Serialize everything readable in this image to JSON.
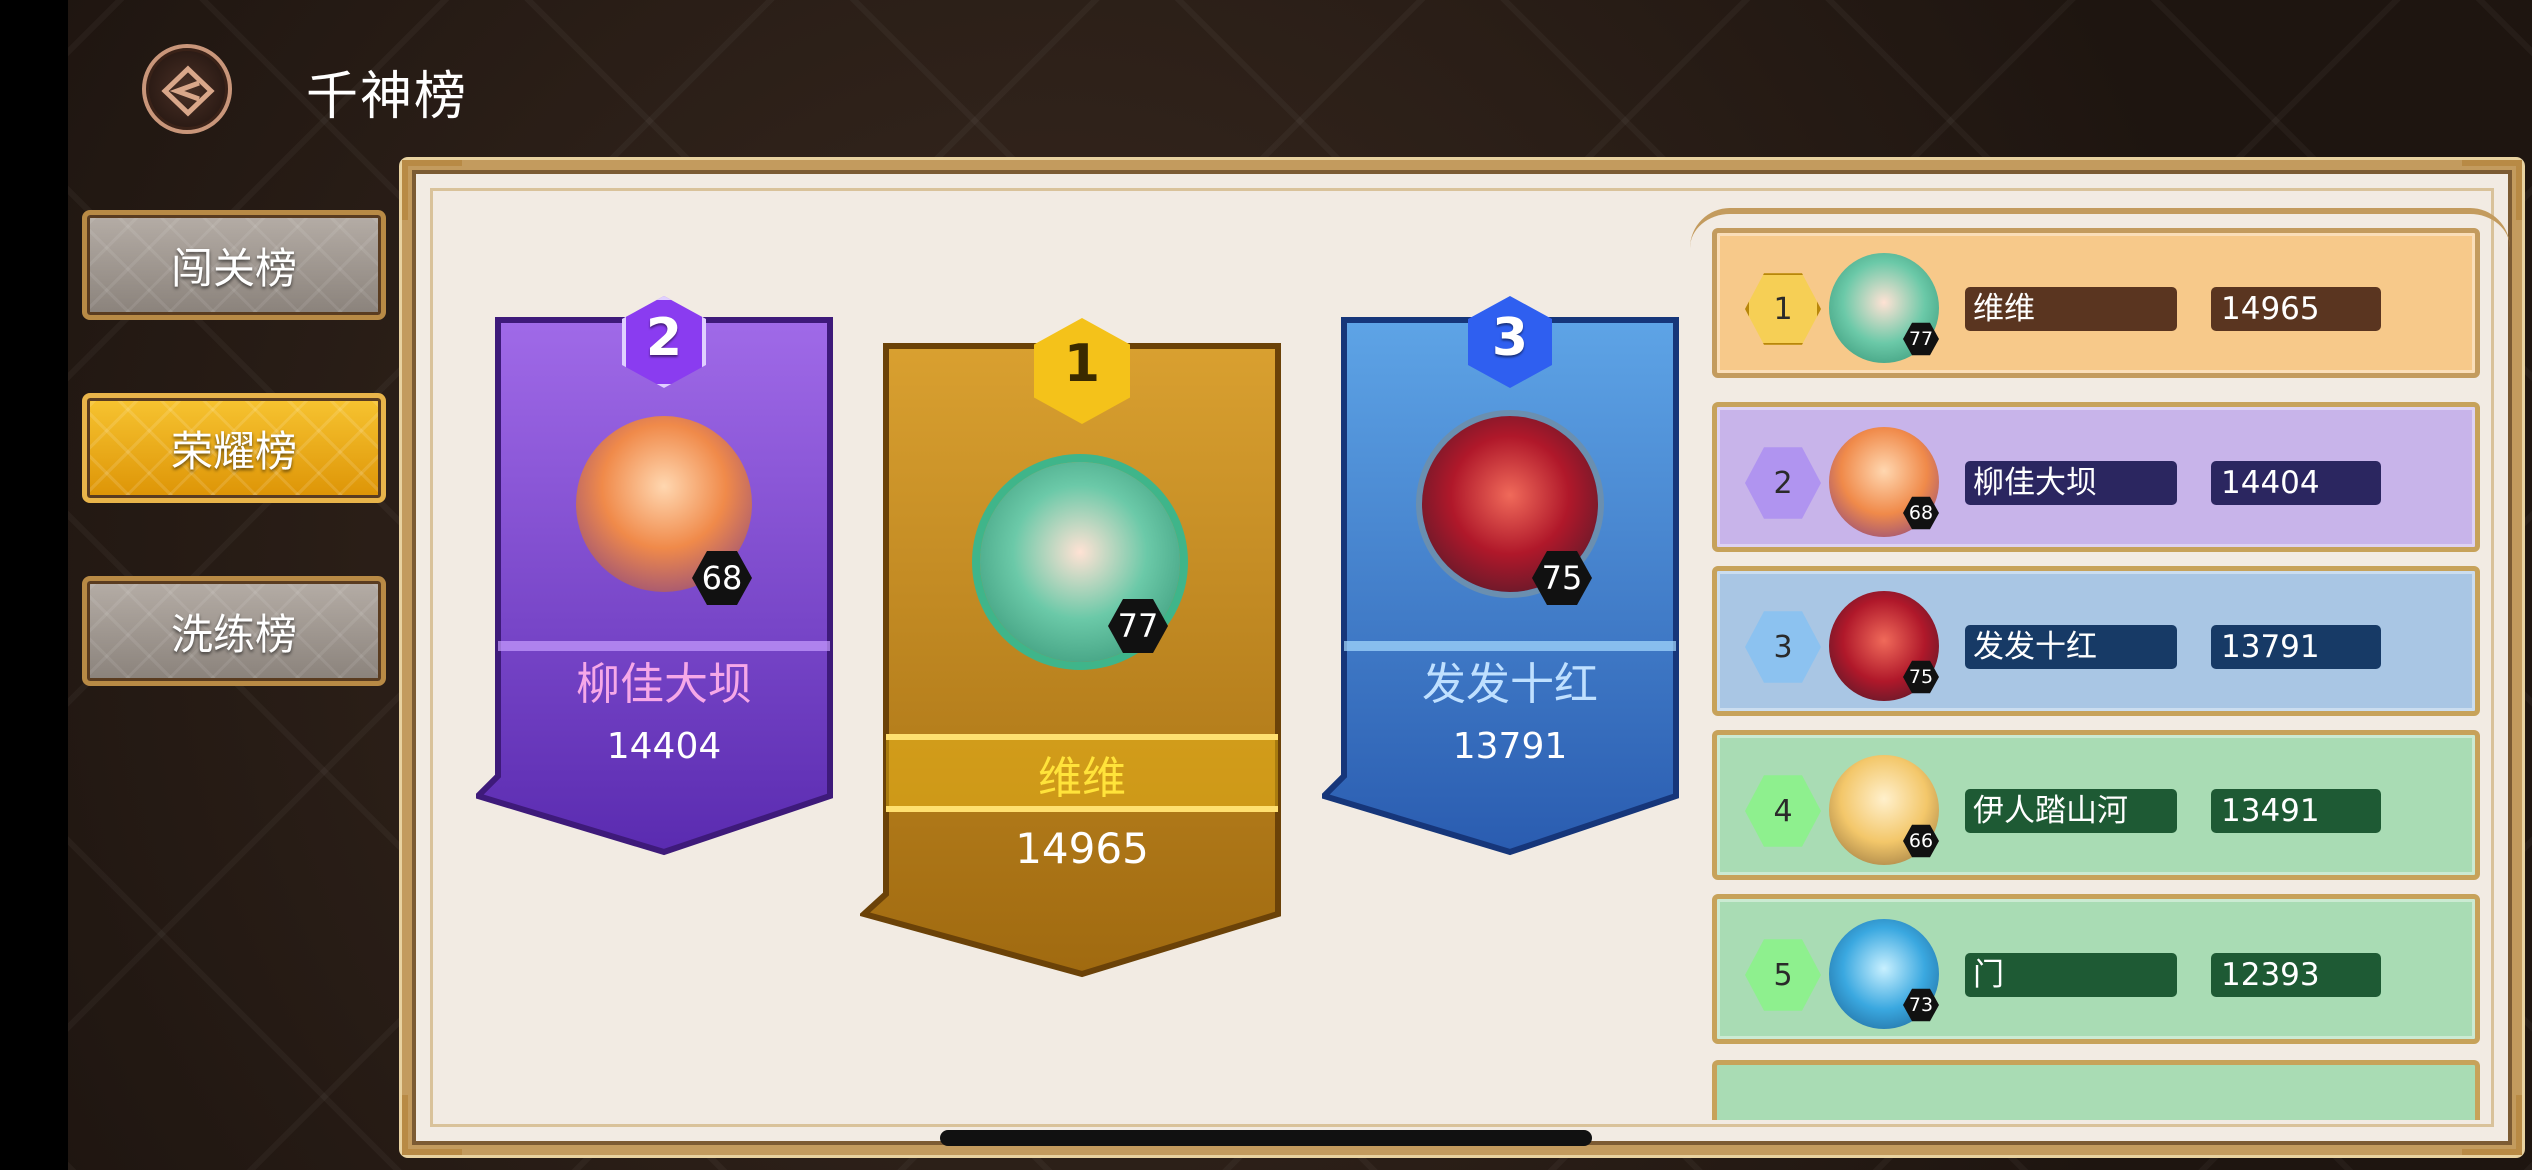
{
  "header": {
    "title": "千神榜",
    "back_icon": "back-arrow-icon"
  },
  "tabs": [
    {
      "label": "闯关榜",
      "active": false
    },
    {
      "label": "荣耀榜",
      "active": true
    },
    {
      "label": "洗练榜",
      "active": false
    }
  ],
  "podium": [
    {
      "rank": "2",
      "name": "柳佳大坝",
      "score": "14404",
      "level": "68",
      "color": "#7a3fd0"
    },
    {
      "rank": "1",
      "name": "维维",
      "score": "14965",
      "level": "77",
      "color": "#c98a12"
    },
    {
      "rank": "3",
      "name": "发发十红",
      "score": "13791",
      "level": "75",
      "color": "#3a7bd0"
    }
  ],
  "ranking": [
    {
      "rank": "1",
      "name": "维维",
      "score": "14965",
      "level": "77"
    },
    {
      "rank": "2",
      "name": "柳佳大坝",
      "score": "14404",
      "level": "68"
    },
    {
      "rank": "3",
      "name": "发发十红",
      "score": "13791",
      "level": "75"
    },
    {
      "rank": "4",
      "name": "伊人踏山河",
      "score": "13491",
      "level": "66"
    },
    {
      "rank": "5",
      "name": "门",
      "score": "12393",
      "level": "73"
    }
  ]
}
